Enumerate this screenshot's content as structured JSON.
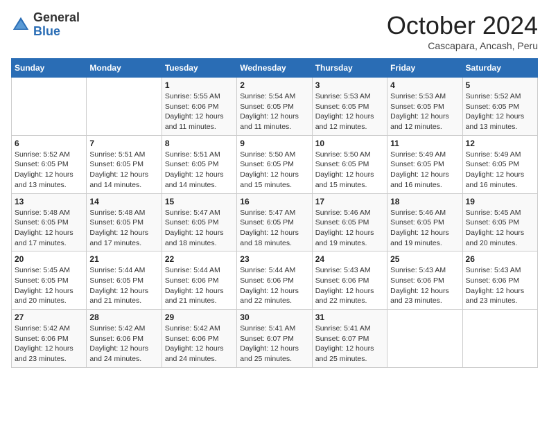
{
  "header": {
    "logo": {
      "general": "General",
      "blue": "Blue"
    },
    "title": "October 2024",
    "location": "Cascapara, Ancash, Peru"
  },
  "weekdays": [
    "Sunday",
    "Monday",
    "Tuesday",
    "Wednesday",
    "Thursday",
    "Friday",
    "Saturday"
  ],
  "weeks": [
    [
      {
        "day": "",
        "sunrise": "",
        "sunset": "",
        "daylight": ""
      },
      {
        "day": "",
        "sunrise": "",
        "sunset": "",
        "daylight": ""
      },
      {
        "day": "1",
        "sunrise": "Sunrise: 5:55 AM",
        "sunset": "Sunset: 6:06 PM",
        "daylight": "Daylight: 12 hours and 11 minutes."
      },
      {
        "day": "2",
        "sunrise": "Sunrise: 5:54 AM",
        "sunset": "Sunset: 6:05 PM",
        "daylight": "Daylight: 12 hours and 11 minutes."
      },
      {
        "day": "3",
        "sunrise": "Sunrise: 5:53 AM",
        "sunset": "Sunset: 6:05 PM",
        "daylight": "Daylight: 12 hours and 12 minutes."
      },
      {
        "day": "4",
        "sunrise": "Sunrise: 5:53 AM",
        "sunset": "Sunset: 6:05 PM",
        "daylight": "Daylight: 12 hours and 12 minutes."
      },
      {
        "day": "5",
        "sunrise": "Sunrise: 5:52 AM",
        "sunset": "Sunset: 6:05 PM",
        "daylight": "Daylight: 12 hours and 13 minutes."
      }
    ],
    [
      {
        "day": "6",
        "sunrise": "Sunrise: 5:52 AM",
        "sunset": "Sunset: 6:05 PM",
        "daylight": "Daylight: 12 hours and 13 minutes."
      },
      {
        "day": "7",
        "sunrise": "Sunrise: 5:51 AM",
        "sunset": "Sunset: 6:05 PM",
        "daylight": "Daylight: 12 hours and 14 minutes."
      },
      {
        "day": "8",
        "sunrise": "Sunrise: 5:51 AM",
        "sunset": "Sunset: 6:05 PM",
        "daylight": "Daylight: 12 hours and 14 minutes."
      },
      {
        "day": "9",
        "sunrise": "Sunrise: 5:50 AM",
        "sunset": "Sunset: 6:05 PM",
        "daylight": "Daylight: 12 hours and 15 minutes."
      },
      {
        "day": "10",
        "sunrise": "Sunrise: 5:50 AM",
        "sunset": "Sunset: 6:05 PM",
        "daylight": "Daylight: 12 hours and 15 minutes."
      },
      {
        "day": "11",
        "sunrise": "Sunrise: 5:49 AM",
        "sunset": "Sunset: 6:05 PM",
        "daylight": "Daylight: 12 hours and 16 minutes."
      },
      {
        "day": "12",
        "sunrise": "Sunrise: 5:49 AM",
        "sunset": "Sunset: 6:05 PM",
        "daylight": "Daylight: 12 hours and 16 minutes."
      }
    ],
    [
      {
        "day": "13",
        "sunrise": "Sunrise: 5:48 AM",
        "sunset": "Sunset: 6:05 PM",
        "daylight": "Daylight: 12 hours and 17 minutes."
      },
      {
        "day": "14",
        "sunrise": "Sunrise: 5:48 AM",
        "sunset": "Sunset: 6:05 PM",
        "daylight": "Daylight: 12 hours and 17 minutes."
      },
      {
        "day": "15",
        "sunrise": "Sunrise: 5:47 AM",
        "sunset": "Sunset: 6:05 PM",
        "daylight": "Daylight: 12 hours and 18 minutes."
      },
      {
        "day": "16",
        "sunrise": "Sunrise: 5:47 AM",
        "sunset": "Sunset: 6:05 PM",
        "daylight": "Daylight: 12 hours and 18 minutes."
      },
      {
        "day": "17",
        "sunrise": "Sunrise: 5:46 AM",
        "sunset": "Sunset: 6:05 PM",
        "daylight": "Daylight: 12 hours and 19 minutes."
      },
      {
        "day": "18",
        "sunrise": "Sunrise: 5:46 AM",
        "sunset": "Sunset: 6:05 PM",
        "daylight": "Daylight: 12 hours and 19 minutes."
      },
      {
        "day": "19",
        "sunrise": "Sunrise: 5:45 AM",
        "sunset": "Sunset: 6:05 PM",
        "daylight": "Daylight: 12 hours and 20 minutes."
      }
    ],
    [
      {
        "day": "20",
        "sunrise": "Sunrise: 5:45 AM",
        "sunset": "Sunset: 6:05 PM",
        "daylight": "Daylight: 12 hours and 20 minutes."
      },
      {
        "day": "21",
        "sunrise": "Sunrise: 5:44 AM",
        "sunset": "Sunset: 6:05 PM",
        "daylight": "Daylight: 12 hours and 21 minutes."
      },
      {
        "day": "22",
        "sunrise": "Sunrise: 5:44 AM",
        "sunset": "Sunset: 6:06 PM",
        "daylight": "Daylight: 12 hours and 21 minutes."
      },
      {
        "day": "23",
        "sunrise": "Sunrise: 5:44 AM",
        "sunset": "Sunset: 6:06 PM",
        "daylight": "Daylight: 12 hours and 22 minutes."
      },
      {
        "day": "24",
        "sunrise": "Sunrise: 5:43 AM",
        "sunset": "Sunset: 6:06 PM",
        "daylight": "Daylight: 12 hours and 22 minutes."
      },
      {
        "day": "25",
        "sunrise": "Sunrise: 5:43 AM",
        "sunset": "Sunset: 6:06 PM",
        "daylight": "Daylight: 12 hours and 23 minutes."
      },
      {
        "day": "26",
        "sunrise": "Sunrise: 5:43 AM",
        "sunset": "Sunset: 6:06 PM",
        "daylight": "Daylight: 12 hours and 23 minutes."
      }
    ],
    [
      {
        "day": "27",
        "sunrise": "Sunrise: 5:42 AM",
        "sunset": "Sunset: 6:06 PM",
        "daylight": "Daylight: 12 hours and 23 minutes."
      },
      {
        "day": "28",
        "sunrise": "Sunrise: 5:42 AM",
        "sunset": "Sunset: 6:06 PM",
        "daylight": "Daylight: 12 hours and 24 minutes."
      },
      {
        "day": "29",
        "sunrise": "Sunrise: 5:42 AM",
        "sunset": "Sunset: 6:06 PM",
        "daylight": "Daylight: 12 hours and 24 minutes."
      },
      {
        "day": "30",
        "sunrise": "Sunrise: 5:41 AM",
        "sunset": "Sunset: 6:07 PM",
        "daylight": "Daylight: 12 hours and 25 minutes."
      },
      {
        "day": "31",
        "sunrise": "Sunrise: 5:41 AM",
        "sunset": "Sunset: 6:07 PM",
        "daylight": "Daylight: 12 hours and 25 minutes."
      },
      {
        "day": "",
        "sunrise": "",
        "sunset": "",
        "daylight": ""
      },
      {
        "day": "",
        "sunrise": "",
        "sunset": "",
        "daylight": ""
      }
    ]
  ]
}
